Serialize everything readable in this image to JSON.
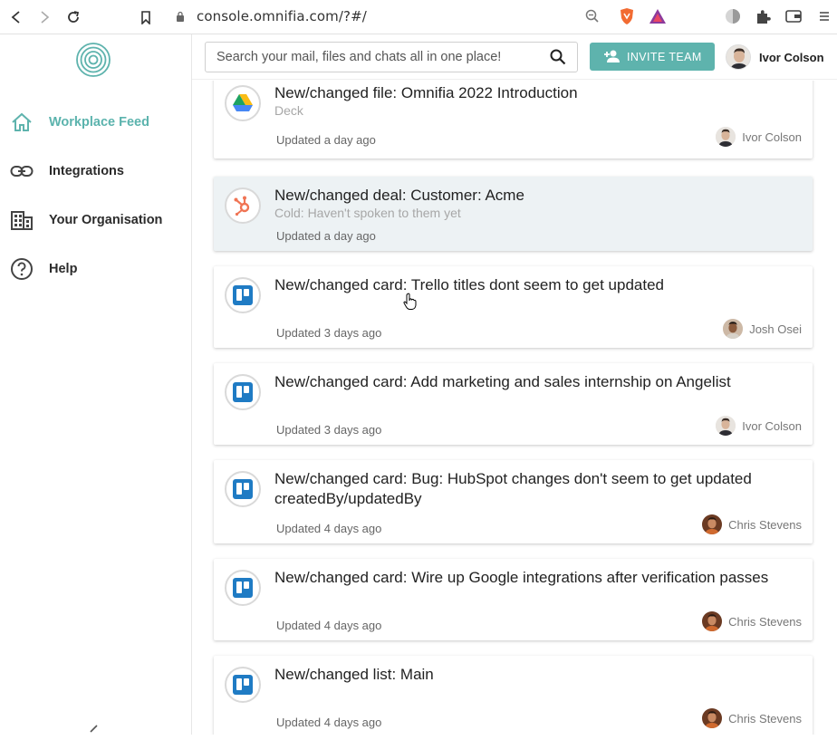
{
  "browser": {
    "url": "console.omnifia.com/?#/"
  },
  "sidebar": {
    "items": [
      {
        "label": "Workplace Feed",
        "icon": "home-icon",
        "active": true
      },
      {
        "label": "Integrations",
        "icon": "link-icon"
      },
      {
        "label": "Your Organisation",
        "icon": "building-icon"
      },
      {
        "label": "Help",
        "icon": "help-circle-icon"
      }
    ]
  },
  "topbar": {
    "search_placeholder": "Search your mail, files and chats all in one place!",
    "invite_label": "INVITE TEAM",
    "user_name": "Ivor Colson"
  },
  "colors": {
    "accent": "#5eb3ad",
    "hubspot": "#f07454",
    "trello": "#1f7bc4"
  },
  "feed": [
    {
      "source": "google-drive",
      "title": "New/changed file: Omnifia 2022 Introduction",
      "subtitle": "Deck",
      "updated": "Updated a day ago",
      "owner": "Ivor Colson"
    },
    {
      "source": "hubspot",
      "title": "New/changed deal: Customer: Acme",
      "subtitle": "Cold: Haven't spoken to them yet",
      "updated": "Updated a day ago",
      "owner": ""
    },
    {
      "source": "trello",
      "title": "New/changed card: Trello titles dont seem to get updated",
      "subtitle": "",
      "updated": "Updated 3 days ago",
      "owner": "Josh Osei"
    },
    {
      "source": "trello",
      "title": "New/changed card: Add marketing and sales internship on Angelist",
      "subtitle": "",
      "updated": "Updated 3 days ago",
      "owner": "Ivor Colson"
    },
    {
      "source": "trello",
      "title": "New/changed card: Bug: HubSpot changes don't seem to get updated createdBy/updatedBy",
      "subtitle": "",
      "updated": "Updated 4 days ago",
      "owner": "Chris Stevens"
    },
    {
      "source": "trello",
      "title": "New/changed card: Wire up Google integrations after verification passes",
      "subtitle": "",
      "updated": "Updated 4 days ago",
      "owner": "Chris Stevens"
    },
    {
      "source": "trello",
      "title": "New/changed list: Main",
      "subtitle": "",
      "updated": "Updated 4 days ago",
      "owner": "Chris Stevens"
    }
  ]
}
